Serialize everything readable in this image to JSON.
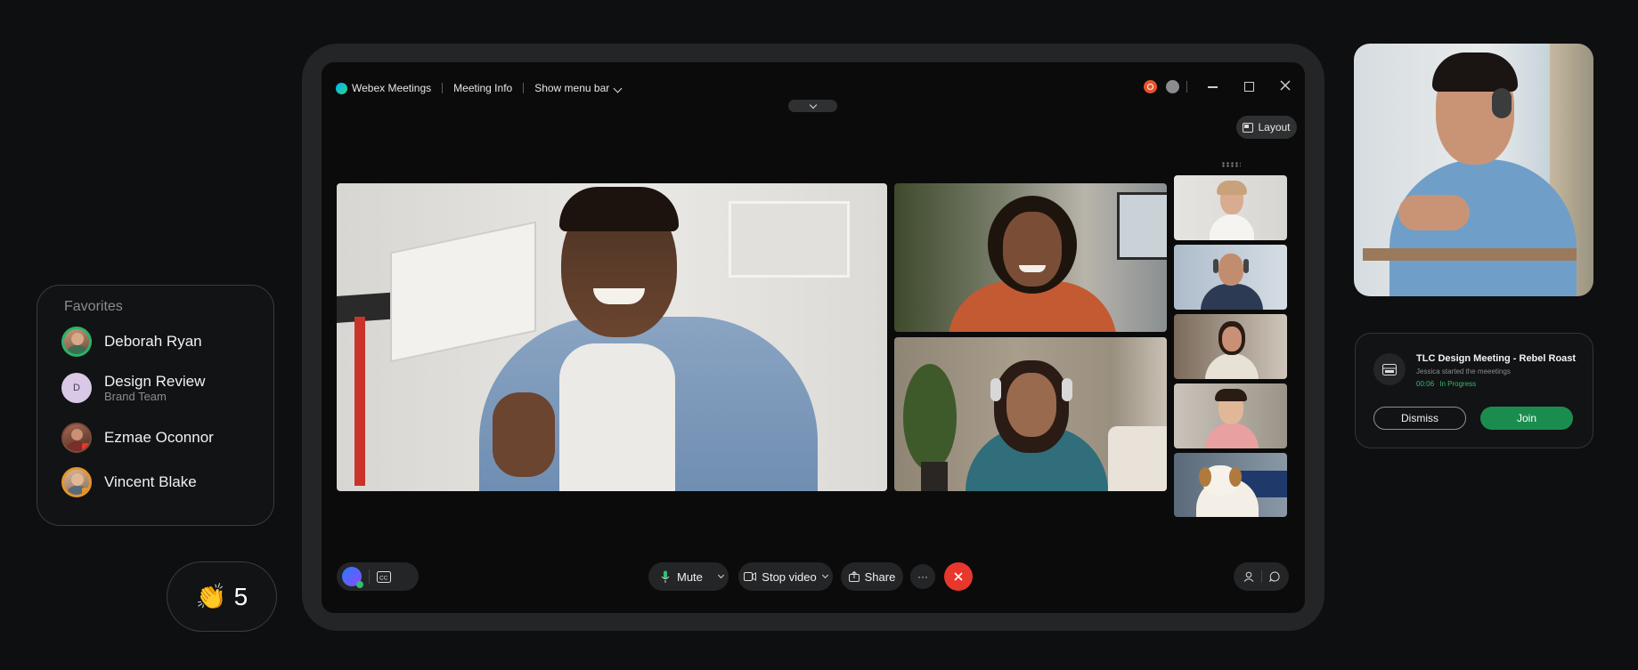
{
  "favorites": {
    "title": "Favorites",
    "items": [
      {
        "name": "Deborah Ryan",
        "subtitle": "",
        "initial": ""
      },
      {
        "name": "Design Review",
        "subtitle": "Brand Team",
        "initial": "D"
      },
      {
        "name": "Ezmae Oconnor",
        "subtitle": "",
        "initial": ""
      },
      {
        "name": "Vincent Blake",
        "subtitle": "",
        "initial": ""
      }
    ]
  },
  "reaction": {
    "emoji": "👏",
    "count": "5"
  },
  "window": {
    "app_name": "Webex Meetings",
    "meeting_info": "Meeting Info",
    "show_menu_bar": "Show menu bar",
    "layout_label": "Layout"
  },
  "controls": {
    "mute_label": "Mute",
    "stop_video_label": "Stop video",
    "share_label": "Share",
    "more_label": "···"
  },
  "notification": {
    "title": "TLC Design Meeting - Rebel Roast",
    "subtitle": "Jessica started the meeetings",
    "time": "00:06",
    "status": "In Progress",
    "dismiss_label": "Dismiss",
    "join_label": "Join"
  },
  "colors": {
    "accent_green": "#1a8d4e",
    "end_call_red": "#e8372c",
    "status_green": "#2fbf6f"
  }
}
